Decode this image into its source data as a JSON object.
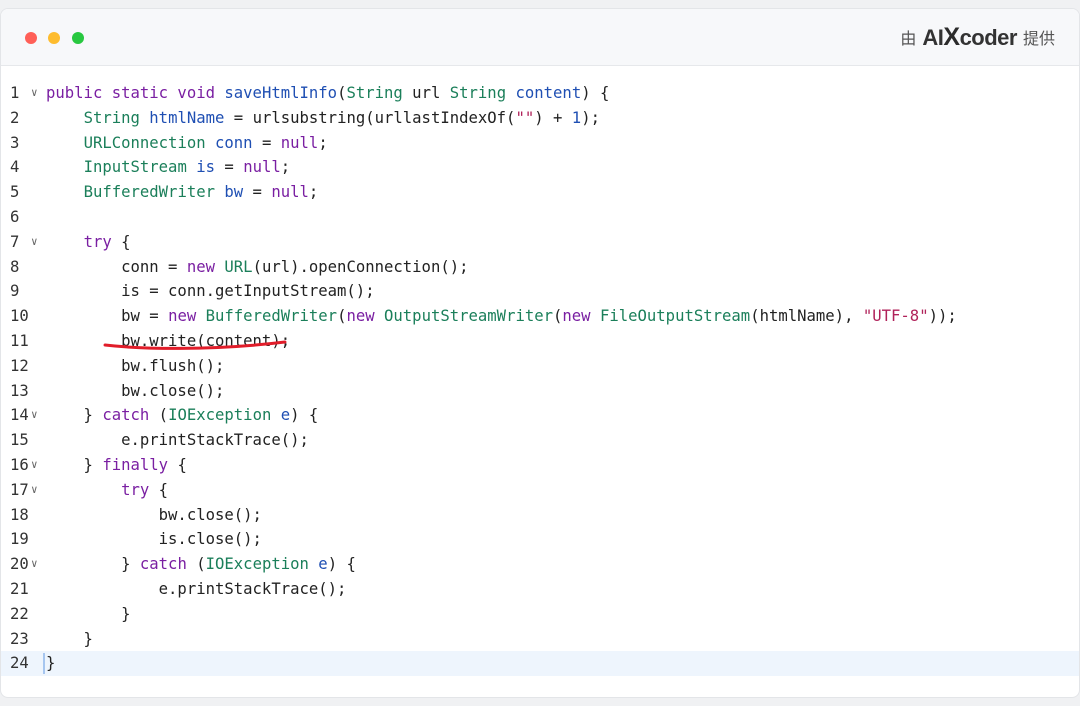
{
  "window": {
    "controls": [
      {
        "name": "close-button",
        "color": "#ff5f57"
      },
      {
        "name": "minimize-button",
        "color": "#febc2e"
      },
      {
        "name": "maximize-button",
        "color": "#28c840"
      }
    ]
  },
  "brand": {
    "prefix": "由",
    "name_part1": "AI",
    "name_x": "X",
    "name_part2": "coder",
    "suffix": "提供"
  },
  "colors": {
    "keyword": "#7a1fa2",
    "type": "#1b7f5a",
    "function": "#1f4fb3",
    "string": "#b0225a",
    "underline": "#e11d2a"
  },
  "code": {
    "highlighted_line": 24,
    "underlined_line": 11,
    "lines": [
      {
        "n": "1",
        "fold": true,
        "segs": [
          [
            "kw",
            "public static void "
          ],
          [
            "fn",
            "saveHtmlInfo"
          ],
          [
            "",
            "("
          ],
          [
            "ty",
            "String"
          ],
          [
            "",
            " url "
          ],
          [
            "ty",
            "String"
          ],
          [
            "",
            " "
          ],
          [
            "vr",
            "content"
          ],
          [
            "",
            ") {"
          ]
        ]
      },
      {
        "n": "2",
        "fold": false,
        "segs": [
          [
            "",
            "    "
          ],
          [
            "ty",
            "String"
          ],
          [
            "",
            " "
          ],
          [
            "vr",
            "htmlName"
          ],
          [
            "",
            " = urlsubstring(urllastIndexOf("
          ],
          [
            "st",
            "\"\""
          ],
          [
            "",
            ") + "
          ],
          [
            "nu",
            "1"
          ],
          [
            "",
            ");"
          ]
        ]
      },
      {
        "n": "3",
        "fold": false,
        "segs": [
          [
            "",
            "    "
          ],
          [
            "ty",
            "URLConnection"
          ],
          [
            "",
            " "
          ],
          [
            "vr",
            "conn"
          ],
          [
            "",
            " = "
          ],
          [
            "kw",
            "null"
          ],
          [
            "",
            ";"
          ]
        ]
      },
      {
        "n": "4",
        "fold": false,
        "segs": [
          [
            "",
            "    "
          ],
          [
            "ty",
            "InputStream"
          ],
          [
            "",
            " "
          ],
          [
            "vr",
            "is"
          ],
          [
            "",
            " = "
          ],
          [
            "kw",
            "null"
          ],
          [
            "",
            ";"
          ]
        ]
      },
      {
        "n": "5",
        "fold": false,
        "segs": [
          [
            "",
            "    "
          ],
          [
            "ty",
            "BufferedWriter"
          ],
          [
            "",
            " "
          ],
          [
            "vr",
            "bw"
          ],
          [
            "",
            " = "
          ],
          [
            "kw",
            "null"
          ],
          [
            "",
            ";"
          ]
        ]
      },
      {
        "n": "6",
        "fold": false,
        "segs": [
          [
            "",
            ""
          ]
        ]
      },
      {
        "n": "7",
        "fold": true,
        "segs": [
          [
            "",
            "    "
          ],
          [
            "kw",
            "try"
          ],
          [
            "",
            " {"
          ]
        ]
      },
      {
        "n": "8",
        "fold": false,
        "segs": [
          [
            "",
            "        conn = "
          ],
          [
            "kw",
            "new"
          ],
          [
            "",
            " "
          ],
          [
            "ty",
            "URL"
          ],
          [
            "",
            "(url).openConnection();"
          ]
        ]
      },
      {
        "n": "9",
        "fold": false,
        "segs": [
          [
            "",
            "        is = conn.getInputStream();"
          ]
        ]
      },
      {
        "n": "10",
        "fold": false,
        "segs": [
          [
            "",
            "        bw = "
          ],
          [
            "kw",
            "new"
          ],
          [
            "",
            " "
          ],
          [
            "ty",
            "BufferedWriter"
          ],
          [
            "",
            "("
          ],
          [
            "kw",
            "new"
          ],
          [
            "",
            " "
          ],
          [
            "ty",
            "OutputStreamWriter"
          ],
          [
            "",
            "("
          ],
          [
            "kw",
            "new"
          ],
          [
            "",
            " "
          ],
          [
            "ty",
            "FileOutputStream"
          ],
          [
            "",
            "(htmlName), "
          ],
          [
            "st",
            "\"UTF-8\""
          ],
          [
            "",
            "));"
          ]
        ]
      },
      {
        "n": "11",
        "fold": false,
        "segs": [
          [
            "",
            "        bw.write(content);"
          ]
        ]
      },
      {
        "n": "12",
        "fold": false,
        "segs": [
          [
            "",
            "        bw.flush();"
          ]
        ]
      },
      {
        "n": "13",
        "fold": false,
        "segs": [
          [
            "",
            "        bw.close();"
          ]
        ]
      },
      {
        "n": "14",
        "fold": true,
        "segs": [
          [
            "",
            "    } "
          ],
          [
            "kw",
            "catch"
          ],
          [
            "",
            " ("
          ],
          [
            "ty",
            "IOException"
          ],
          [
            "",
            " "
          ],
          [
            "vr",
            "e"
          ],
          [
            "",
            ") {"
          ]
        ]
      },
      {
        "n": "15",
        "fold": false,
        "segs": [
          [
            "",
            "        e.printStackTrace();"
          ]
        ]
      },
      {
        "n": "16",
        "fold": true,
        "segs": [
          [
            "",
            "    } "
          ],
          [
            "kw",
            "finally"
          ],
          [
            "",
            " {"
          ]
        ]
      },
      {
        "n": "17",
        "fold": true,
        "segs": [
          [
            "",
            "        "
          ],
          [
            "kw",
            "try"
          ],
          [
            "",
            " {"
          ]
        ]
      },
      {
        "n": "18",
        "fold": false,
        "segs": [
          [
            "",
            "            bw.close();"
          ]
        ]
      },
      {
        "n": "19",
        "fold": false,
        "segs": [
          [
            "",
            "            is.close();"
          ]
        ]
      },
      {
        "n": "20",
        "fold": true,
        "segs": [
          [
            "",
            "        } "
          ],
          [
            "kw",
            "catch"
          ],
          [
            "",
            " ("
          ],
          [
            "ty",
            "IOException"
          ],
          [
            "",
            " "
          ],
          [
            "vr",
            "e"
          ],
          [
            "",
            ") {"
          ]
        ]
      },
      {
        "n": "21",
        "fold": false,
        "segs": [
          [
            "",
            "            e.printStackTrace();"
          ]
        ]
      },
      {
        "n": "22",
        "fold": false,
        "segs": [
          [
            "",
            "        }"
          ]
        ]
      },
      {
        "n": "23",
        "fold": false,
        "segs": [
          [
            "",
            "    }"
          ]
        ]
      },
      {
        "n": "24",
        "fold": false,
        "segs": [
          [
            "",
            "}"
          ]
        ]
      }
    ]
  }
}
